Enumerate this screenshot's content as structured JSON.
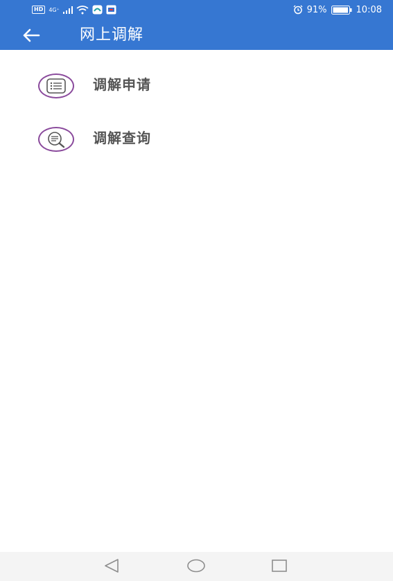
{
  "statusbar": {
    "hd": "HD",
    "network": "4G⁺",
    "battery_percent": "91%",
    "time": "10:08"
  },
  "header": {
    "title": "网上调解"
  },
  "menu": [
    {
      "label": "调解申请",
      "icon": "list-icon"
    },
    {
      "label": "调解查询",
      "icon": "search-doc-icon"
    }
  ],
  "colors": {
    "primary": "#3677d2",
    "icon_accent": "#8a4a9c",
    "label_text": "#555555"
  },
  "navbar": {
    "buttons": [
      "back-triangle-icon",
      "home-circle-icon",
      "recents-square-icon"
    ]
  }
}
